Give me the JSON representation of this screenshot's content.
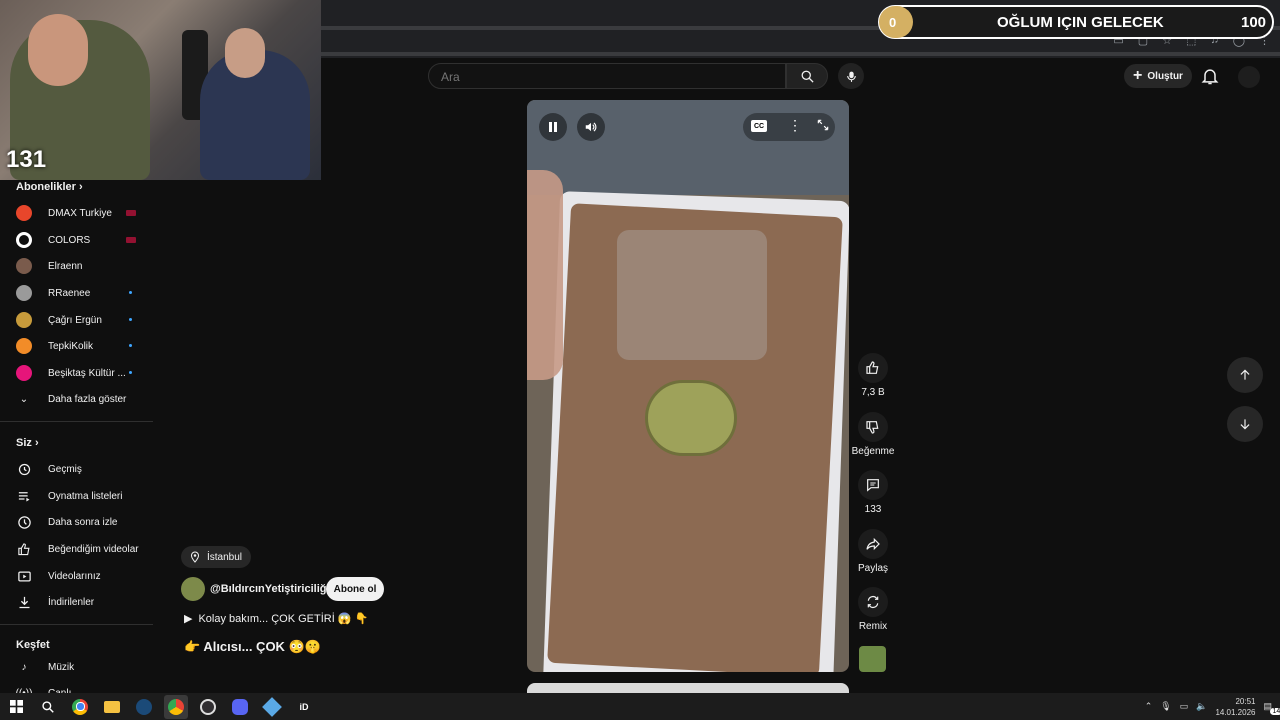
{
  "overlay": {
    "webcam_count": "131",
    "goal": {
      "start": "0",
      "title": "OĞLUM IÇIN GELECEK",
      "end": "100"
    }
  },
  "header": {
    "search_placeholder": "Ara",
    "create_label": "Oluştur"
  },
  "sidebar": {
    "subscriptions_title": "Abonelikler",
    "channels": [
      {
        "name": "DMAX Turkiye",
        "color": "#e8462b",
        "status": "live"
      },
      {
        "name": "COLORS",
        "color": "#ffffff",
        "status": "live"
      },
      {
        "name": "Elraenn",
        "color": "#7a5b4c",
        "status": ""
      },
      {
        "name": "RRaenee",
        "color": "#9a9a9a",
        "status": "new"
      },
      {
        "name": "Çağrı Ergün",
        "color": "#c79b3b",
        "status": "new"
      },
      {
        "name": "TepkiKolik",
        "color": "#f28c28",
        "status": "new"
      },
      {
        "name": "Beşiktaş Kültür ...",
        "color": "#e6157a",
        "status": "new"
      }
    ],
    "show_more": "Daha fazla göster",
    "you_title": "Siz",
    "you_items": [
      "Geçmiş",
      "Oynatma listeleri",
      "Daha sonra izle",
      "Beğendiğim videolar",
      "Videolarınız",
      "İndirilenler"
    ],
    "explore_title": "Keşfet",
    "explore_items": [
      "Müzik",
      "Canlı"
    ]
  },
  "short": {
    "location": "İstanbul",
    "channel": "@BıldırcınYetiştiriciliği",
    "subscribe": "Abone ol",
    "caption_line1": "Kolay bakım... ÇOK GETİRİ 😱 👇",
    "caption_line2": "👉 Alıcısı... ÇOK 😳🤫"
  },
  "actions": {
    "likes": "7,3 B",
    "dislike": "Beğenme",
    "comments": "133",
    "share": "Paylaş",
    "remix": "Remix"
  },
  "taskbar": {
    "time": "20:51",
    "date": "14.01.2026",
    "notifications": "14"
  }
}
